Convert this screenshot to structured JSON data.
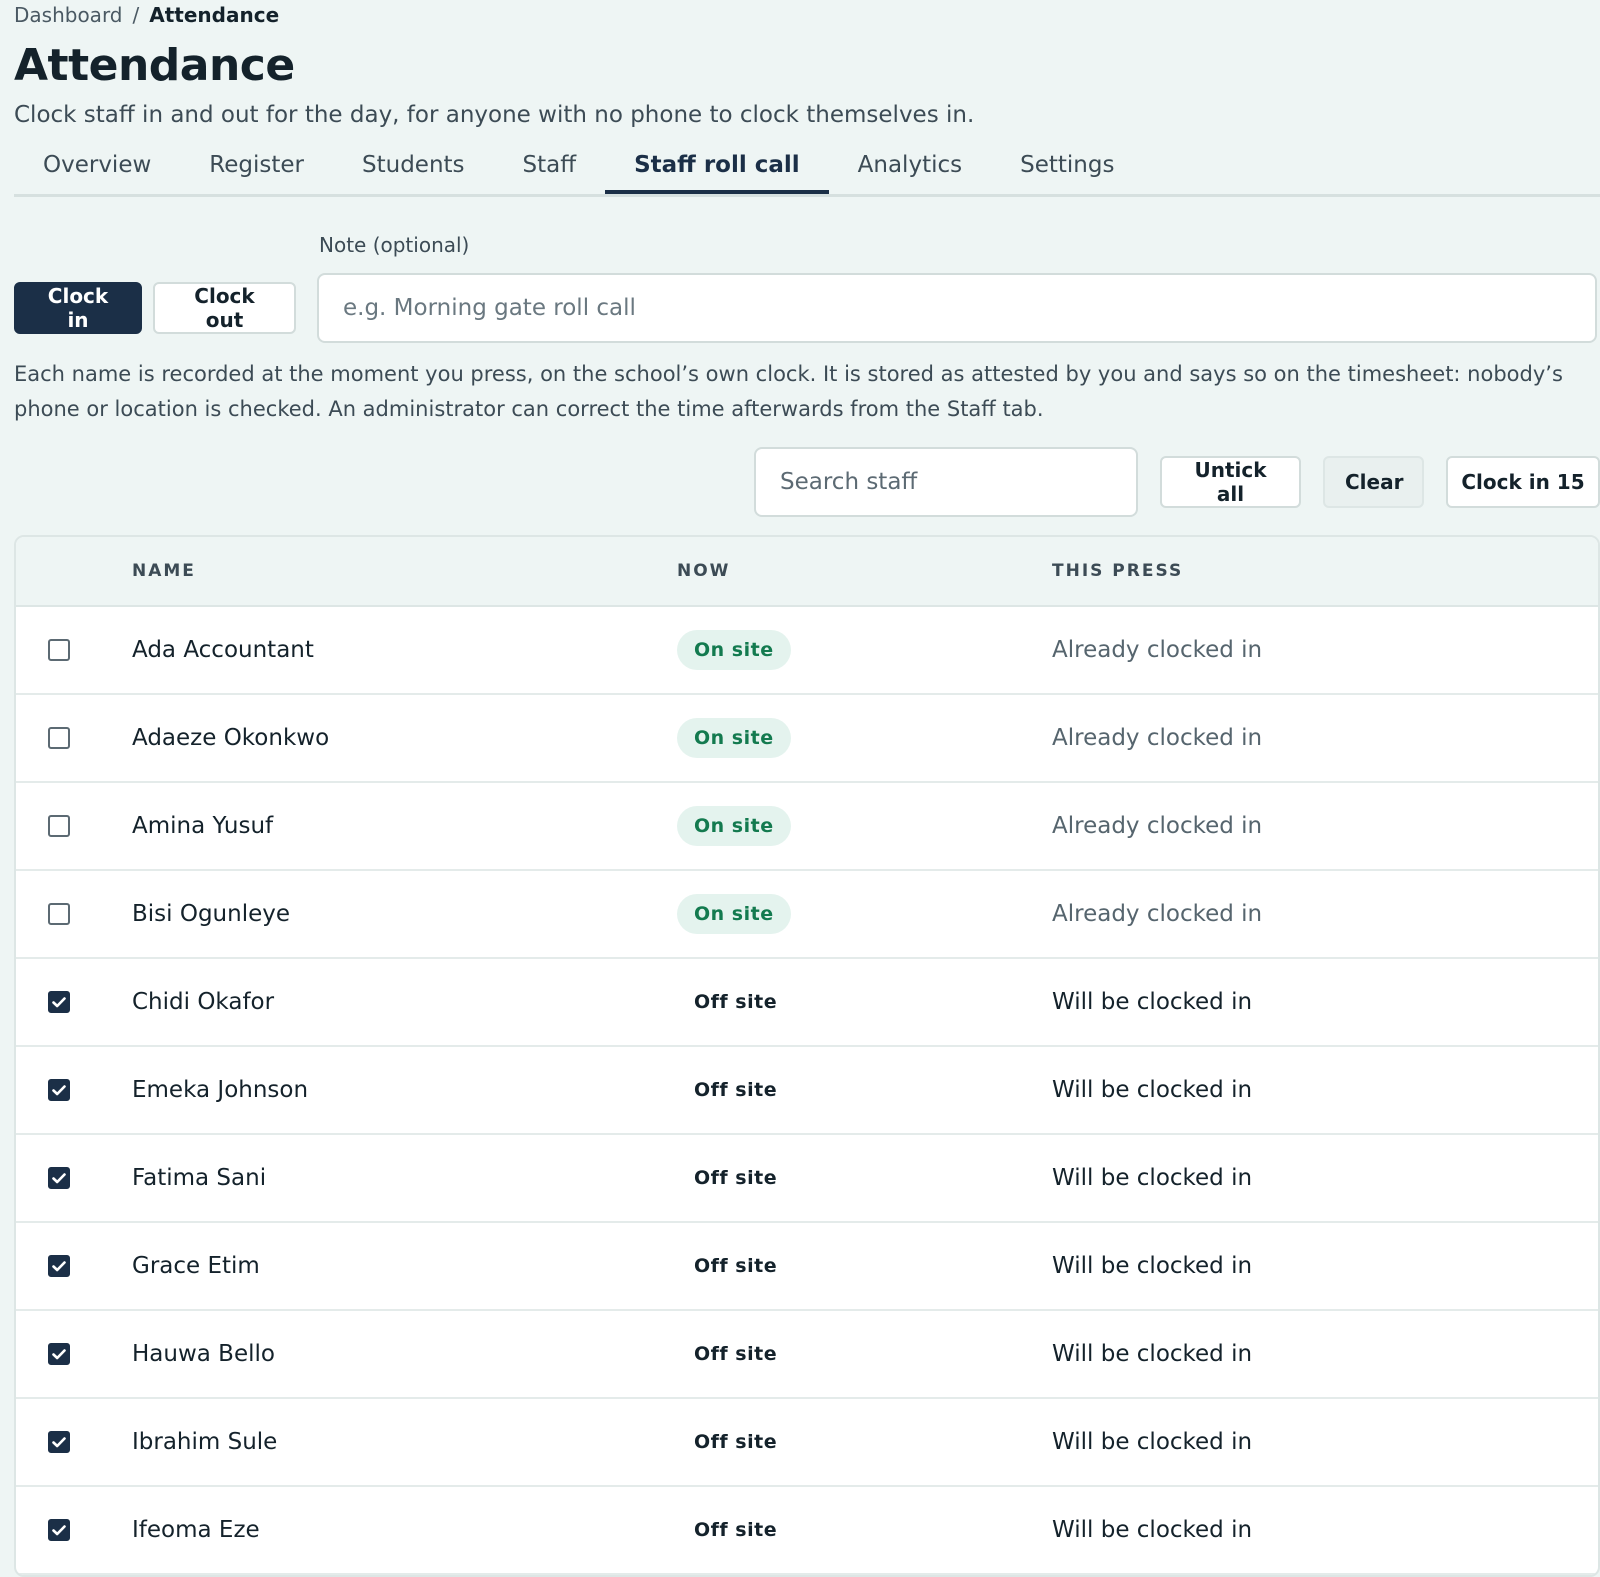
{
  "breadcrumb": {
    "parent": "Dashboard",
    "separator": "/",
    "current": "Attendance"
  },
  "page": {
    "title": "Attendance",
    "subtitle": "Clock staff in and out for the day, for anyone with no phone to clock themselves in."
  },
  "tabs": [
    {
      "label": "Overview",
      "active": false
    },
    {
      "label": "Register",
      "active": false
    },
    {
      "label": "Students",
      "active": false
    },
    {
      "label": "Staff",
      "active": false
    },
    {
      "label": "Staff roll call",
      "active": true
    },
    {
      "label": "Analytics",
      "active": false
    },
    {
      "label": "Settings",
      "active": false
    }
  ],
  "form": {
    "note_label": "Note (optional)",
    "note_placeholder": "e.g. Morning gate roll call",
    "note_value": "",
    "clock_in_label": "Clock in",
    "clock_out_label": "Clock out",
    "info": "Each name is recorded at the moment you press, on the school’s own clock. It is stored as attested by you and says so on the timesheet: nobody’s phone or location is checked. An administrator can correct the time afterwards from the Staff tab."
  },
  "toolbar": {
    "search_placeholder": "Search staff",
    "untick_all_label": "Untick all",
    "clear_label": "Clear",
    "clock_in_count_label": "Clock in 15"
  },
  "table": {
    "headers": {
      "name": "NAME",
      "now": "NOW",
      "press": "THIS PRESS"
    },
    "rows": [
      {
        "name": "Ada Accountant",
        "now": "On site",
        "status": "on",
        "press": "Already clocked in",
        "checked": false
      },
      {
        "name": "Adaeze Okonkwo",
        "now": "On site",
        "status": "on",
        "press": "Already clocked in",
        "checked": false
      },
      {
        "name": "Amina Yusuf",
        "now": "On site",
        "status": "on",
        "press": "Already clocked in",
        "checked": false
      },
      {
        "name": "Bisi Ogunleye",
        "now": "On site",
        "status": "on",
        "press": "Already clocked in",
        "checked": false
      },
      {
        "name": "Chidi Okafor",
        "now": "Off site",
        "status": "off",
        "press": "Will be clocked in",
        "checked": true
      },
      {
        "name": "Emeka Johnson",
        "now": "Off site",
        "status": "off",
        "press": "Will be clocked in",
        "checked": true
      },
      {
        "name": "Fatima Sani",
        "now": "Off site",
        "status": "off",
        "press": "Will be clocked in",
        "checked": true
      },
      {
        "name": "Grace Etim",
        "now": "Off site",
        "status": "off",
        "press": "Will be clocked in",
        "checked": true
      },
      {
        "name": "Hauwa Bello",
        "now": "Off site",
        "status": "off",
        "press": "Will be clocked in",
        "checked": true
      },
      {
        "name": "Ibrahim Sule",
        "now": "Off site",
        "status": "off",
        "press": "Will be clocked in",
        "checked": true
      },
      {
        "name": "Ifeoma Eze",
        "now": "Off site",
        "status": "off",
        "press": "Will be clocked in",
        "checked": true
      }
    ]
  },
  "colors": {
    "primary": "#1b2f47",
    "on_site_bg": "#e4f3ee",
    "on_site_text": "#137a4f",
    "background": "#eef5f4"
  }
}
